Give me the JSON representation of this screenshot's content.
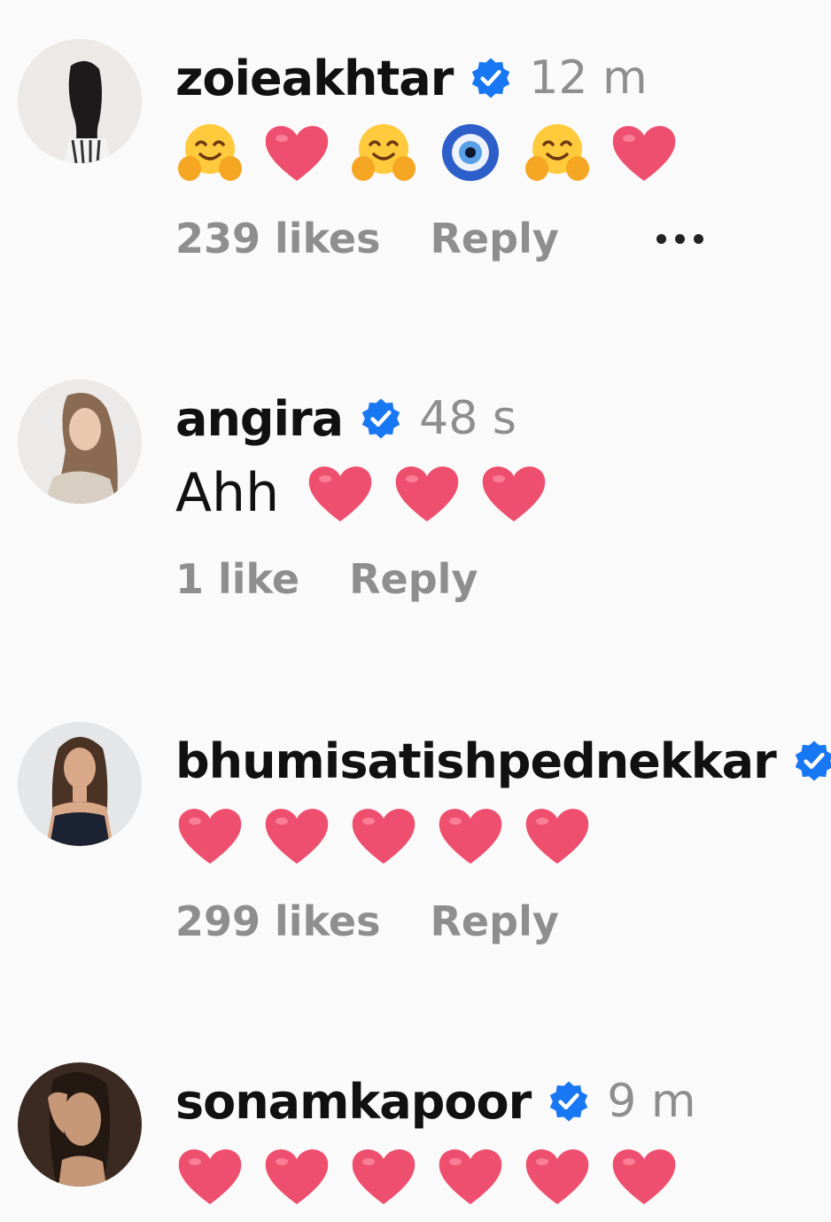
{
  "comments": [
    {
      "username": "zoieakhtar",
      "verified": true,
      "timestamp": "12 m",
      "text": "",
      "emojis": [
        "hugging-face",
        "red-heart",
        "hugging-face",
        "nazar-amulet",
        "hugging-face",
        "red-heart"
      ],
      "likes": "239 likes",
      "reply": "Reply",
      "has_more": true
    },
    {
      "username": "angira",
      "verified": true,
      "timestamp": "48 s",
      "text": "Ahh",
      "emojis": [
        "red-heart",
        "red-heart",
        "red-heart"
      ],
      "likes": "1 like",
      "reply": "Reply",
      "has_more": false
    },
    {
      "username": "bhumisatishpednekkar",
      "verified": true,
      "timestamp": "",
      "text": "",
      "emojis": [
        "red-heart",
        "red-heart",
        "red-heart",
        "red-heart",
        "red-heart"
      ],
      "likes": "299 likes",
      "reply": "Reply",
      "has_more": false
    },
    {
      "username": "sonamkapoor",
      "verified": true,
      "timestamp": "9 m",
      "text": "",
      "emojis": [
        "red-heart",
        "red-heart",
        "red-heart",
        "red-heart",
        "red-heart",
        "red-heart"
      ],
      "likes": "",
      "reply": "",
      "has_more": false
    }
  ],
  "colors": {
    "verified_badge": "#1877f2",
    "heart": "#ef4f6e",
    "secondary_text": "#8e8e8e"
  }
}
